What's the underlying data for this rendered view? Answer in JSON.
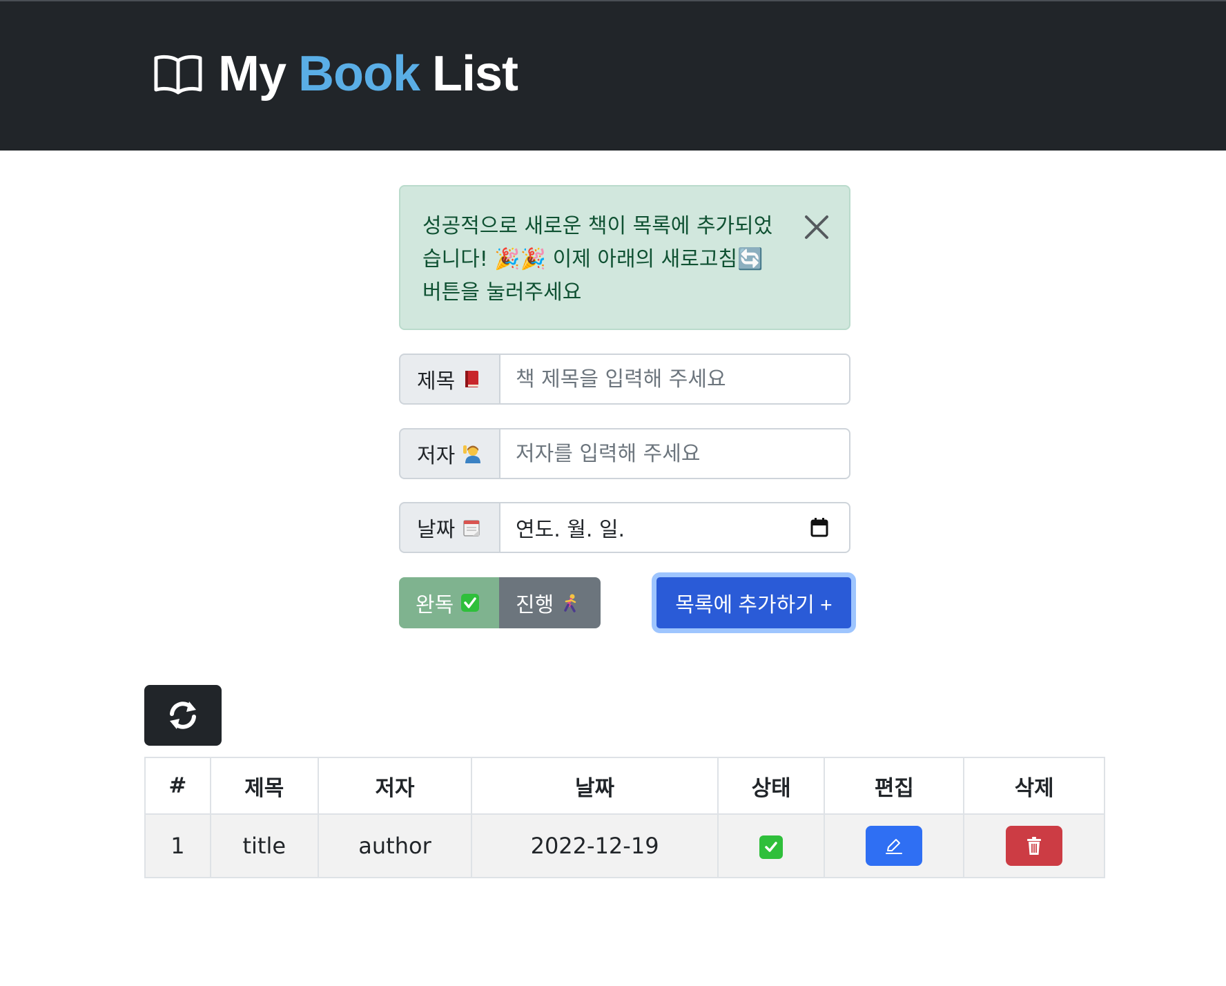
{
  "navbar": {
    "brand_prefix": "My",
    "brand_accent": "Book",
    "brand_suffix": "List",
    "brand_icon": "open-book-icon",
    "accent_color": "#5aaee6"
  },
  "alert": {
    "message": "성공적으로 새로운 책이 목록에 추가되었습니다! 🎉🎉 이제 아래의 새로고침🔄 버튼을 눌러주세요",
    "close_icon": "close-icon"
  },
  "form": {
    "title_label": "제목",
    "title_placeholder": "책 제목을 입력해 주세요",
    "author_label": "저자",
    "author_placeholder": "저자를 입력해 주세요",
    "date_label": "날짜",
    "date_placeholder": "연도. 월. 일.",
    "status_done_label": "완독",
    "status_progress_label": "진행",
    "submit_label": "목록에 추가하기 +"
  },
  "table": {
    "headers": [
      "#",
      "제목",
      "저자",
      "날짜",
      "상태",
      "편집",
      "삭제"
    ],
    "rows": [
      {
        "num": "1",
        "title": "title",
        "author": "author",
        "date": "2022-12-19",
        "status": "check-icon"
      }
    ]
  },
  "colors": {
    "navbar_bg": "#212529",
    "alert_bg": "#d1e7dd",
    "done_button": "#7fb38f",
    "progress_button": "#6c757d",
    "primary": "#2a5bd7",
    "edit_button": "#2f6ff3",
    "delete_button": "#cc3c44"
  }
}
